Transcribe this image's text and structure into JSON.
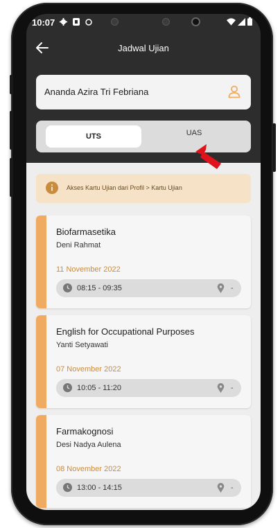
{
  "status_bar": {
    "time": "10:07"
  },
  "app_bar": {
    "title": "Jadwal Ujian",
    "back_icon": "arrow-left-icon"
  },
  "user": {
    "name": "Ananda Azira Tri Febriana",
    "icon": "person-icon"
  },
  "tabs": [
    {
      "label": "UTS",
      "selected": true
    },
    {
      "label": "UAS",
      "selected": false
    }
  ],
  "info_banner": {
    "text": "Akses Kartu Ujian dari Profil > Kartu Ujian",
    "icon": "info-icon"
  },
  "exams": [
    {
      "course": "Biofarmasetika",
      "lecturer": "Deni Rahmat",
      "date": "11 November 2022",
      "time": "08:15 - 09:35",
      "room": "-"
    },
    {
      "course": "English for Occupational Purposes",
      "lecturer": "Yanti Setyawati",
      "date": "07 November 2022",
      "time": "10:05 - 11:20",
      "room": "-"
    },
    {
      "course": "Farmakognosi",
      "lecturer": "Desi Nadya Aulena",
      "date": "08 November 2022",
      "time": "13:00 - 14:15",
      "room": "-"
    }
  ],
  "colors": {
    "accent": "#f0ab63",
    "date": "#c98b3e",
    "banner": "#f6e3c7",
    "header": "#2d2d2d",
    "pointer_arrow": "#e0121b"
  }
}
